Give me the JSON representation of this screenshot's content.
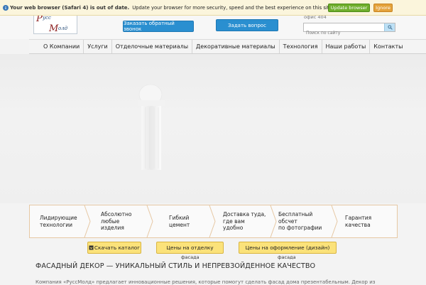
{
  "outdated_bar": {
    "title": "Your web browser (Safari 4) is out of date.",
    "message": "Update your browser for more security, speed and the best experience on this site.",
    "update_label": "Update browser",
    "ignore_label": "Ignore"
  },
  "header": {
    "logo_text_top": "усс",
    "logo_text_bottom": "олд",
    "callback_label": "Заказать обратный звонок",
    "ask_label": "Задать вопрос",
    "office": "офис 404",
    "search_placeholder": "Поиск по сайту"
  },
  "nav": {
    "items": [
      "О Компании",
      "Услуги",
      "Отделочные материалы",
      "Декоративные материалы",
      "Технология",
      "Наши работы",
      "Контакты"
    ]
  },
  "features": [
    {
      "line1": "Лидирующие",
      "line2": "технологии",
      "line3": ""
    },
    {
      "line1": "Абсолютно",
      "line2": "любые",
      "line3": "изделия"
    },
    {
      "line1": "Гибкий",
      "line2": "цемент",
      "line3": ""
    },
    {
      "line1": "Доставка туда,",
      "line2": "где вам",
      "line3": "удобно"
    },
    {
      "line1": "Бесплатный",
      "line2": "обсчет",
      "line3": "по фотографии"
    },
    {
      "line1": "Гарантия",
      "line2": "качества",
      "line3": ""
    }
  ],
  "actions": {
    "catalog_label": "Скачать каталог",
    "price_finish_label": "Цены на отделку",
    "price_finish_sub": "фасада",
    "price_design_label": "Цены на оформление (дизайн)",
    "price_design_sub": "фасада"
  },
  "content": {
    "heading": "ФАСАДНЫЙ ДЕКОР — УНИКАЛЬНЫЙ СТИЛЬ И НЕПРЕВЗОЙДЕННОЕ КАЧЕСТВО",
    "paragraph": "Компания «РуссМолд» предлагает инновационные решения, которые помогут сделать фасад дома презентабельным. Декор из"
  },
  "colors": {
    "accent_blue": "#2a8fd0",
    "update_green": "#6fae2c",
    "ignore_orange": "#e4a23a",
    "yellow_button": "#fbe27a",
    "feature_border": "#e6c8a4"
  }
}
